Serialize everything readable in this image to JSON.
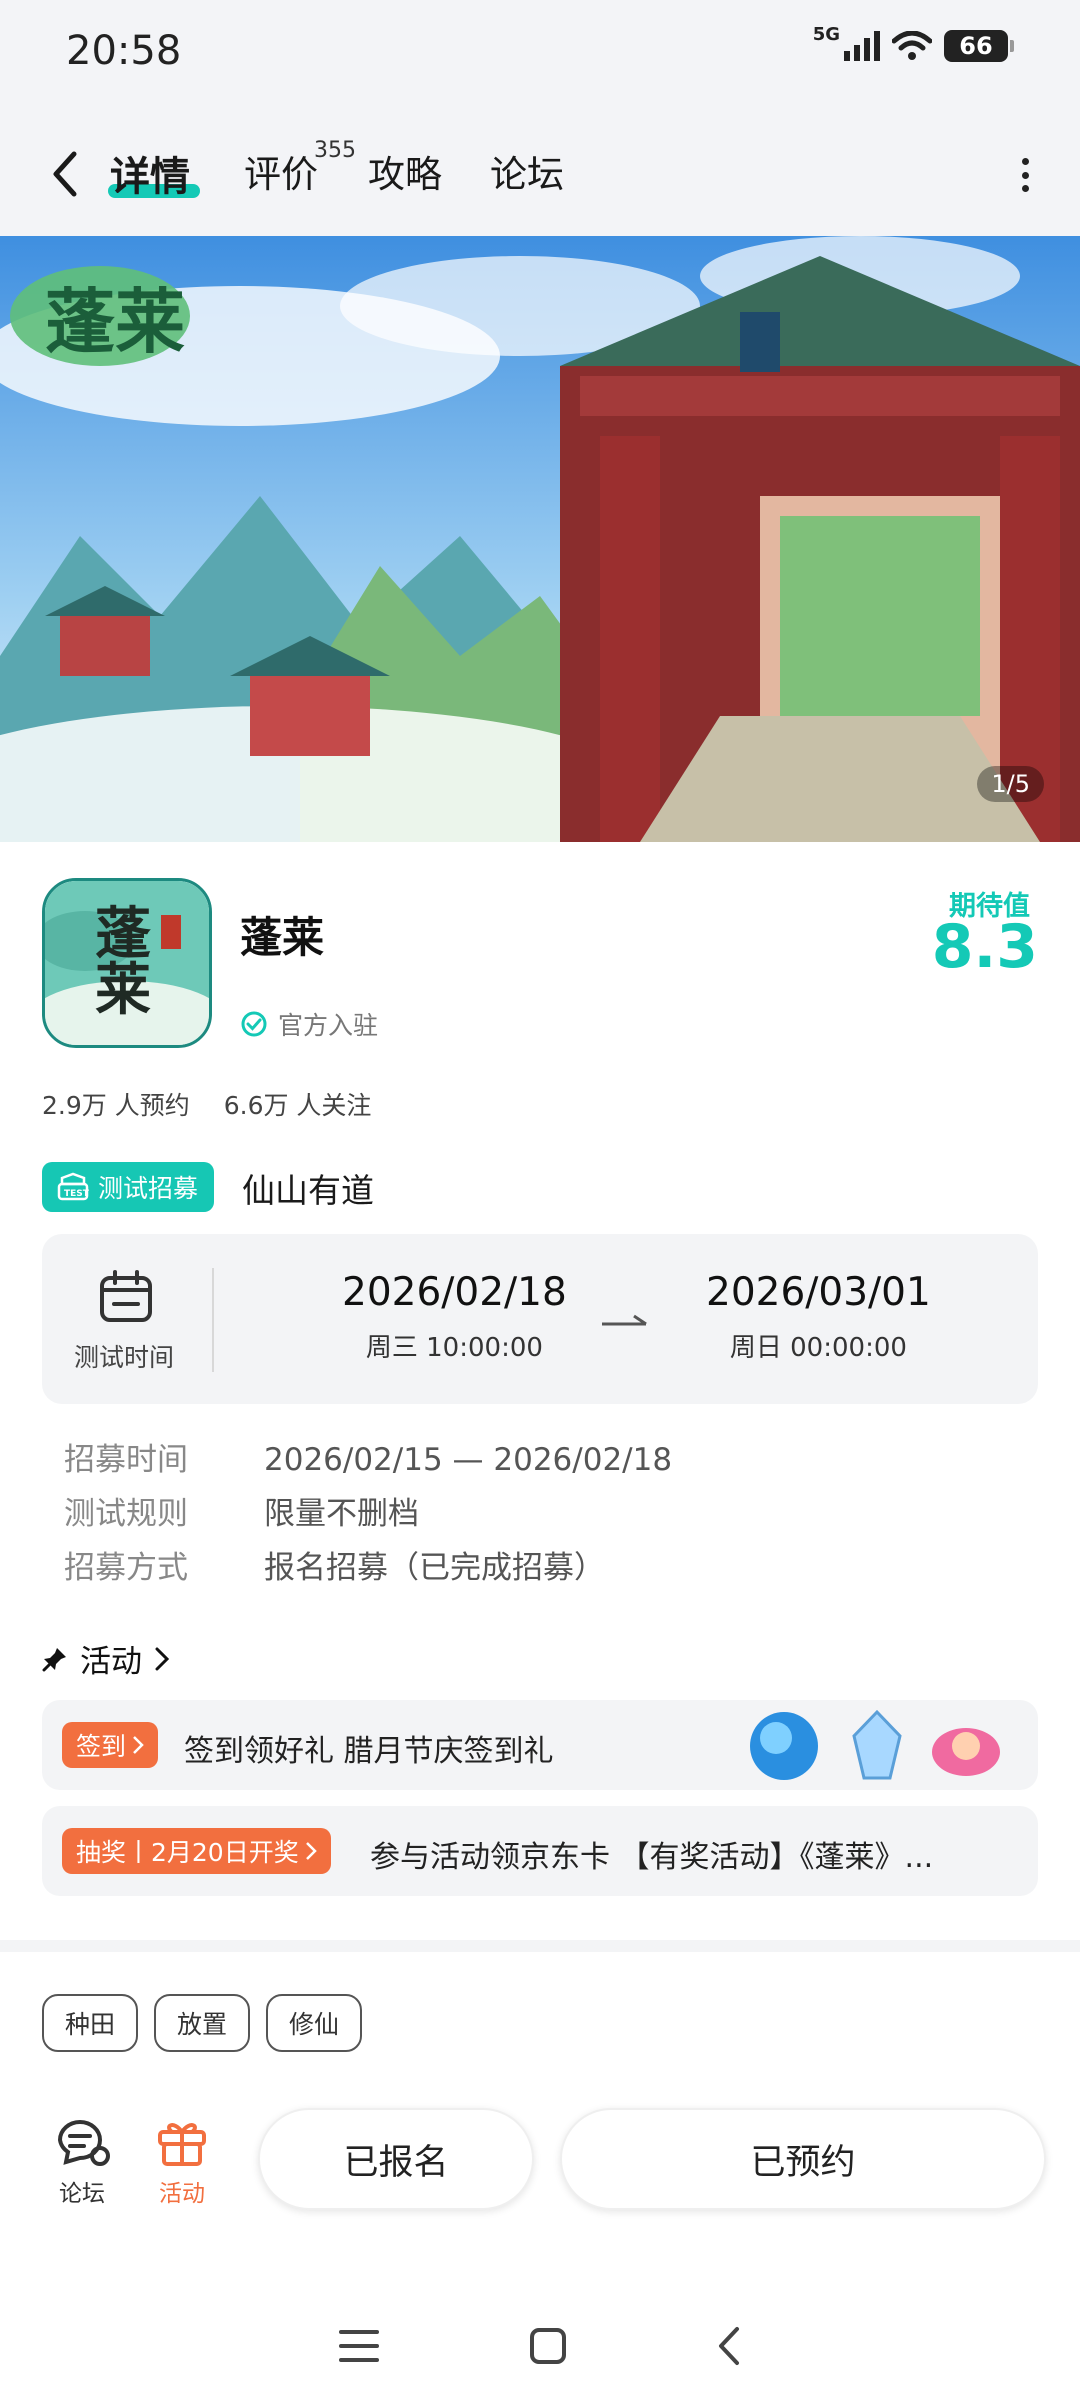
{
  "status_bar": {
    "time": "20:58",
    "network": "5G",
    "battery": "66"
  },
  "nav": {
    "tabs": [
      {
        "label": "详情"
      },
      {
        "label": "评价"
      },
      {
        "label": "攻略"
      },
      {
        "label": "论坛"
      }
    ],
    "review_count": "355"
  },
  "banner": {
    "counter": "1/5"
  },
  "game": {
    "name": "蓬莱",
    "official_label": "官方入驻",
    "expect_label": "期待值",
    "expect_value": "8.3",
    "reservations": "2.9万 人预约",
    "followers": "6.6万 人关注"
  },
  "recruit": {
    "badge": "测试招募",
    "title": "仙山有道",
    "test_time_label": "测试时间",
    "start_date": "2026/02/18",
    "start_time": "周三  10:00:00",
    "end_date": "2026/03/01",
    "end_time": "周日  00:00:00",
    "details": [
      {
        "key": "招募时间",
        "value": "2026/02/15 — 2026/02/18"
      },
      {
        "key": "测试规则",
        "value": "限量不删档"
      },
      {
        "key": "招募方式",
        "value": "报名招募（已完成招募）"
      }
    ]
  },
  "activity": {
    "header": "活动",
    "items": [
      {
        "tag": "签到",
        "text": "签到领好礼 腊月节庆签到礼"
      },
      {
        "tag": "抽奖丨2月20日开奖",
        "text": "参与活动领京东卡 【有奖活动】《蓬莱》..."
      }
    ]
  },
  "tags": [
    "种田",
    "放置",
    "修仙"
  ],
  "bottom_bar": {
    "forum_label": "论坛",
    "activity_label": "活动",
    "signup_button": "已报名",
    "reserve_button": "已预约"
  },
  "colors": {
    "accent": "#14c9b6",
    "orange": "#f26f3f",
    "activity_label": "#f26f3f"
  }
}
